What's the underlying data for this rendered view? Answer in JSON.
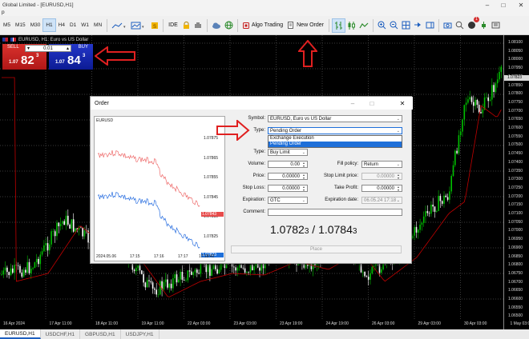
{
  "window": {
    "title": "Global Limited - [EURUSD,H1]",
    "menu_fragment": "p"
  },
  "toolbar": {
    "timeframes": [
      "M5",
      "M15",
      "M30",
      "H1",
      "H4",
      "D1",
      "W1",
      "MN"
    ],
    "active_timeframe": "H1",
    "ide_label": "IDE",
    "algo_trading_label": "Algo Trading",
    "new_order_label": "New Order",
    "notification_count": "1"
  },
  "symbol_info": {
    "text": "EURUSD, H1:  Euro vs US Dollar"
  },
  "one_click": {
    "sell_label": "SELL",
    "buy_label": "BUY",
    "volume": "0.01",
    "sell_price_prefix": "1.07",
    "sell_price_big": "82",
    "sell_price_sup": "3",
    "buy_price_prefix": "1.07",
    "buy_price_big": "84",
    "buy_price_sup": "3"
  },
  "price_scale": {
    "labels": [
      "1.08100",
      "1.08050",
      "1.08000",
      "1.07950",
      "1.07900",
      "1.07850",
      "1.07800",
      "1.07750",
      "1.07700",
      "1.07650",
      "1.07600",
      "1.07550",
      "1.07500",
      "1.07450",
      "1.07400",
      "1.07350",
      "1.07300",
      "1.07250",
      "1.07200",
      "1.07150",
      "1.07100",
      "1.07050",
      "1.07000",
      "1.06950",
      "1.06900",
      "1.06850",
      "1.06800",
      "1.06750",
      "1.06700",
      "1.06650",
      "1.06600",
      "1.06550",
      "1.06500"
    ],
    "current": "1.07823"
  },
  "time_axis": [
    "16 Apr 2024",
    "17 Apr 11:00",
    "18 Apr 11:00",
    "19 Apr 11:00",
    "22 Apr 03:00",
    "23 Apr 03:00",
    "23 Apr 19:00",
    "24 Apr 19:00",
    "26 Apr 03:00",
    "29 Apr 03:00",
    "30 Apr 03:00",
    "1 May 03:00",
    "2 May 03:00",
    "3 May 11:00",
    "6 May 19:00"
  ],
  "chart_tabs": [
    "EURUSD,H1",
    "USDCHF,H1",
    "GBPUSD,H1",
    "USDJPY,H1"
  ],
  "active_chart_tab": "EURUSD,H1",
  "order_dialog": {
    "title": "Order",
    "mini_chart": {
      "symbol": "EURUSD",
      "price_labels": [
        "1.07875",
        "1.07865",
        "1.07855",
        "1.07845",
        "1.07835",
        "1.07825"
      ],
      "bid_tag": "1.07823",
      "ask_tag": "1.07843",
      "time_labels": [
        "2024.05.06",
        "17:15",
        "17:16",
        "17:17",
        "17:18:42"
      ]
    },
    "fields": {
      "symbol_label": "Symbol:",
      "symbol_value": "EURUSD, Euro vs US Dollar",
      "type_label": "Type:",
      "type_value": "Pending Order",
      "type_options": [
        "Exchange Execution",
        "Pending Order"
      ],
      "type_selected": "Pending Order",
      "subtype_label": "Type:",
      "subtype_value": "Buy Limit",
      "volume_label": "Volume:",
      "volume_value": "0.00",
      "fill_policy_label": "Fill policy:",
      "fill_policy_value": "Return",
      "price_label": "Price:",
      "price_value": "0.00000",
      "stop_limit_label": "Stop Limit price:",
      "stop_limit_value": "0.00000",
      "stop_loss_label": "Stop Loss:",
      "stop_loss_value": "0.00000",
      "take_profit_label": "Take Profit:",
      "take_profit_value": "0.00000",
      "expiration_label": "Expiration:",
      "expiration_value": "GTC",
      "expiration_date_label": "Expiration date:",
      "expiration_date_value": "06.05.24 17:18",
      "comment_label": "Comment:",
      "comment_value": ""
    },
    "bid_big": "1.0782",
    "bid_small": "3",
    "separator": " / ",
    "ask_big": "1.0784",
    "ask_small": "3",
    "place_label": "Place"
  },
  "colors": {
    "bull": "#00c000",
    "bear": "#ffffff",
    "ma": "#c00000",
    "sell": "#c62020",
    "buy": "#1426b5",
    "annotation": "#e02020"
  }
}
